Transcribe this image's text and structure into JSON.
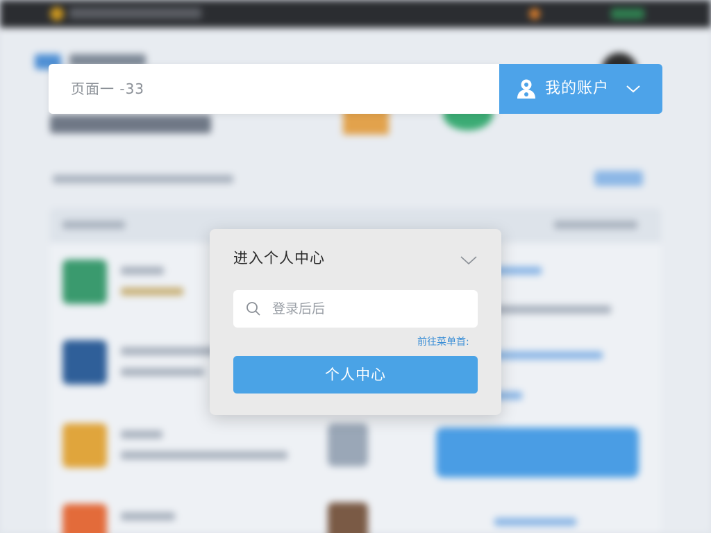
{
  "search_bar": {
    "value": "页面一 -33"
  },
  "account": {
    "label": "我的账户"
  },
  "dialog": {
    "title": "进入个人中心",
    "input_placeholder": "登录后后",
    "link_text": "前往菜单首:",
    "primary_button_label": "个人中心"
  },
  "colors": {
    "accent": "#4da3e9",
    "dialog_bg": "#eaeaea",
    "link": "#3a8ed6"
  },
  "icons": {
    "account": "user-icon",
    "account_dropdown": "chevron-down-icon",
    "dialog_collapse": "chevron-down-icon",
    "search": "search-icon"
  }
}
